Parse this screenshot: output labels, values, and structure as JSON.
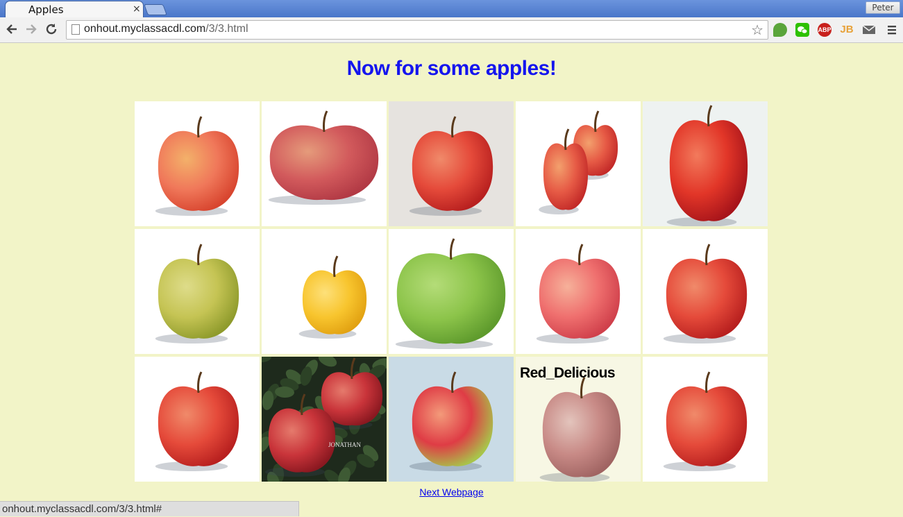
{
  "browser": {
    "tab_title": "Apples",
    "tab_close": "×",
    "profile_name": "Peter",
    "url_host": "onhout.myclassacdl.com",
    "url_path": "/3/3.html",
    "status_text": "onhout.myclassacdl.com/3/3.html#",
    "extensions": [
      "evernote-icon",
      "wechat-icon",
      "adblock-plus-icon",
      "jetbrains-icon",
      "gmail-icon"
    ],
    "extension_labels": {
      "adblock": "ABP",
      "jetbrains": "JB"
    }
  },
  "page": {
    "heading": "Now for some apples!",
    "next_link": "Next Webpage",
    "heading_color": "#1515ee",
    "background": "#f2f4c8"
  },
  "gallery": {
    "rows": [
      [
        {
          "name": "apple-1",
          "kind": "gala",
          "bg": "#ffffff"
        },
        {
          "name": "apple-2",
          "kind": "fuji-wide",
          "bg": "#ffffff"
        },
        {
          "name": "apple-3",
          "kind": "red",
          "bg": "#e6e3df"
        },
        {
          "name": "apple-4",
          "kind": "two-red",
          "bg": "#ffffff"
        },
        {
          "name": "apple-5",
          "kind": "tall-red",
          "bg": "#eef2f1"
        }
      ],
      [
        {
          "name": "apple-6",
          "kind": "yellow-green",
          "bg": "#ffffff"
        },
        {
          "name": "apple-7",
          "kind": "golden",
          "bg": "#ffffff"
        },
        {
          "name": "apple-8",
          "kind": "granny-smith",
          "bg": "#ffffff"
        },
        {
          "name": "apple-9",
          "kind": "pink",
          "bg": "#ffffff"
        },
        {
          "name": "apple-10",
          "kind": "red",
          "bg": "#ffffff"
        }
      ],
      [
        {
          "name": "apple-11",
          "kind": "red",
          "bg": "#ffffff"
        },
        {
          "name": "apple-12",
          "kind": "jonathan",
          "bg": "#1e2a1c",
          "caption": "JONATHAN"
        },
        {
          "name": "apple-13",
          "kind": "red-green",
          "bg": "#c9dbe6"
        },
        {
          "name": "apple-14",
          "kind": "broken-alt",
          "bg": "#f7f7e4",
          "alt_text": "Red_Delicious"
        },
        {
          "name": "apple-15",
          "kind": "red",
          "bg": "#ffffff"
        }
      ]
    ]
  }
}
